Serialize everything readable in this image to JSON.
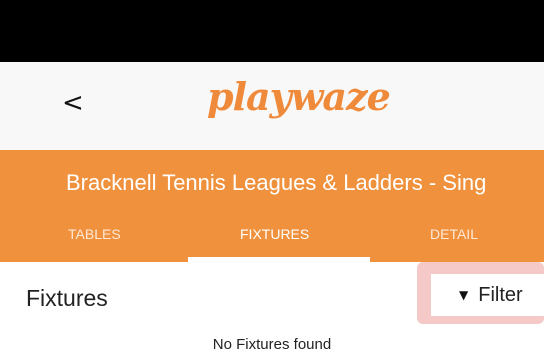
{
  "header": {
    "back_label": "<",
    "logo_text": "playwaze"
  },
  "league": {
    "title": "Bracknell Tennis Leagues & Ladders - Sing"
  },
  "tabs": [
    {
      "label": "TABLES"
    },
    {
      "label": "FIXTURES",
      "active": true
    },
    {
      "label": "DETAIL"
    }
  ],
  "section": {
    "title": "Fixtures",
    "filter_icon": "▼",
    "filter_label": "Filter"
  },
  "fixtures": {
    "empty_message": "No Fixtures found"
  },
  "colors": {
    "brand_orange": "#f0913d",
    "logo_orange": "#f08a3b",
    "highlight": "#f4c9c7"
  }
}
